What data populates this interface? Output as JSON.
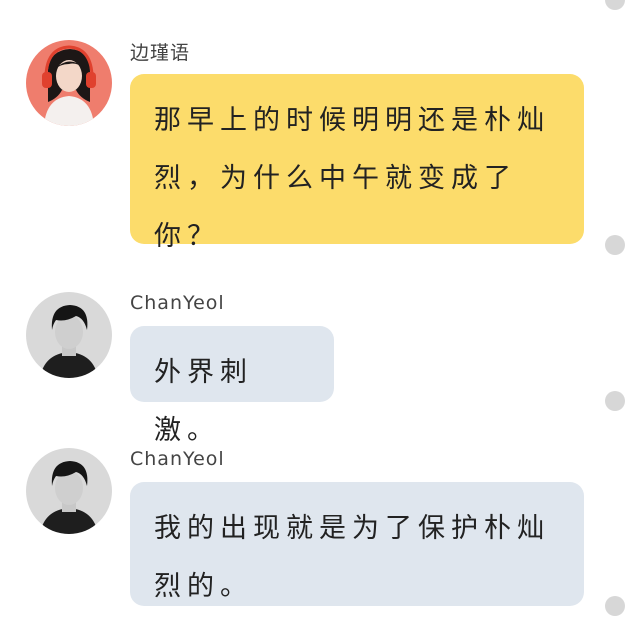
{
  "messages": [
    {
      "sender": "边瑾语",
      "text": "那早上的时候明明还是朴灿烈，为什么中午就变成了你？",
      "avatar": "girl-with-headphones-avatar",
      "bubble_color": "#fcdc6b"
    },
    {
      "sender": "ChanYeol",
      "text": "外界刺激。",
      "avatar": "young-man-portrait-avatar",
      "bubble_color": "#dfe6ee"
    },
    {
      "sender": "ChanYeol",
      "text": "我的出现就是为了保护朴灿烈的。",
      "avatar": "young-man-portrait-avatar",
      "bubble_color": "#dfe6ee"
    }
  ],
  "colors": {
    "background": "#ffffff",
    "status_dot": "#d7d7d7"
  }
}
